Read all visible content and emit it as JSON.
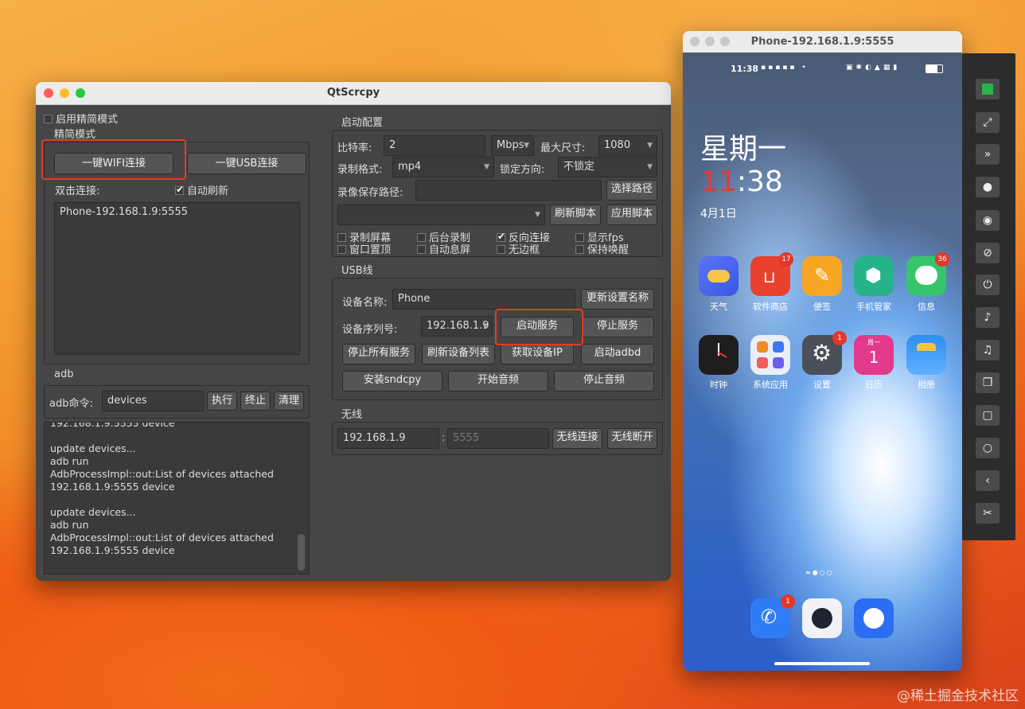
{
  "qtwin": {
    "title": "QtScrcpy",
    "simple_mode_checkbox": "启用精简模式",
    "simple_mode_group": "精简模式",
    "wifi_connect": "一键WIFI连接",
    "usb_connect": "一键USB连接",
    "double_click_label": "双击连接:",
    "auto_refresh": "自动刷新",
    "device_list": [
      "Phone-192.168.1.9:5555"
    ],
    "adb_group": "adb",
    "adb_cmd_label": "adb命令:",
    "adb_cmd_value": "devices",
    "adb_exec": "执行",
    "adb_stop": "终止",
    "adb_clear": "清理",
    "log_lines": [
      "192.168.1.9:5555            device",
      "",
      "update devices...",
      "adb run",
      "AdbProcessImpl::out:List of devices attached",
      "192.168.1.9:5555            device",
      "",
      "update devices...",
      "adb run",
      "AdbProcessImpl::out:List of devices attached",
      "192.168.1.9:5555            device"
    ],
    "start_config": {
      "title": "启动配置",
      "bitrate_label": "比特率:",
      "bitrate_value": "2",
      "bitrate_unit": "Mbps",
      "max_size_label": "最大尺寸:",
      "max_size_value": "1080",
      "record_format_label": "录制格式:",
      "record_format_value": "mp4",
      "lock_dir_label": "锁定方向:",
      "lock_dir_value": "不锁定",
      "record_path_label": "录像保存路径:",
      "record_path_value": "",
      "select_path": "选择路径",
      "refresh_script": "刷新脚本",
      "apply_script": "应用脚本",
      "checkboxes": [
        {
          "label": "录制屏幕",
          "checked": false
        },
        {
          "label": "后台录制",
          "checked": false
        },
        {
          "label": "反向连接",
          "checked": true
        },
        {
          "label": "显示fps",
          "checked": false
        },
        {
          "label": "窗口置顶",
          "checked": false
        },
        {
          "label": "自动息屏",
          "checked": false
        },
        {
          "label": "无边框",
          "checked": false
        },
        {
          "label": "保持唤醒",
          "checked": false
        }
      ]
    },
    "usb": {
      "title": "USB线",
      "device_name_label": "设备名称:",
      "device_name_value": "Phone",
      "update_name": "更新设置名称",
      "serial_label": "设备序列号:",
      "serial_value": "192.168.1.9",
      "start_service": "启动服务",
      "stop_service": "停止服务",
      "stop_all": "停止所有服务",
      "refresh_devices": "刷新设备列表",
      "get_ip": "获取设备IP",
      "start_adbd": "启动adbd",
      "install_sndcpy": "安装sndcpy",
      "start_audio": "开始音频",
      "stop_audio": "停止音频"
    },
    "wireless": {
      "title": "无线",
      "ip_value": "192.168.1.9",
      "port_placeholder": "5555",
      "connect": "无线连接",
      "disconnect": "无线断开"
    }
  },
  "phone": {
    "window_title": "Phone-192.168.1.9:5555",
    "status_time": "11:38",
    "weekday": "星期一",
    "clock_hour": "11",
    "clock_rest": ":38",
    "date": "4月1日",
    "apps_row1": [
      {
        "label": "天气",
        "color": "#4a6cf0",
        "badge": ""
      },
      {
        "label": "软件商店",
        "color": "#e8412e",
        "badge": "17"
      },
      {
        "label": "便签",
        "color": "#f6a623",
        "badge": ""
      },
      {
        "label": "手机管家",
        "color": "#27b38a",
        "badge": ""
      },
      {
        "label": "信息",
        "color": "#36c56b",
        "badge": "36"
      }
    ],
    "apps_row2": [
      {
        "label": "时钟",
        "color": "#1e1e1e",
        "badge": ""
      },
      {
        "label": "系统应用",
        "color": "#e9eef7",
        "badge": ""
      },
      {
        "label": "设置",
        "color": "#4b4f58",
        "badge": "1"
      },
      {
        "label": "日历",
        "color": "#e23a8c",
        "badge": ""
      },
      {
        "label": "相册",
        "color": "#2e8ef3",
        "badge": ""
      }
    ],
    "calendar_day": "1",
    "calendar_weekday": "周一",
    "dock": [
      {
        "name": "phone",
        "color": "#2f7cf6",
        "badge": "1"
      },
      {
        "name": "camera",
        "color": "#f2f2f6",
        "badge": ""
      },
      {
        "name": "browser",
        "color": "#2b6ef3",
        "badge": ""
      }
    ]
  },
  "toolbar_icons": [
    "green-square-icon",
    "fullscreen-icon",
    "expand-icon",
    "record-icon",
    "eye-icon",
    "eye-off-icon",
    "power-icon",
    "volume-up-icon",
    "volume-down-icon",
    "copy-icon",
    "square-icon",
    "home-circle-icon",
    "back-icon",
    "scissors-icon"
  ],
  "watermark": "@稀土掘金技术社区"
}
